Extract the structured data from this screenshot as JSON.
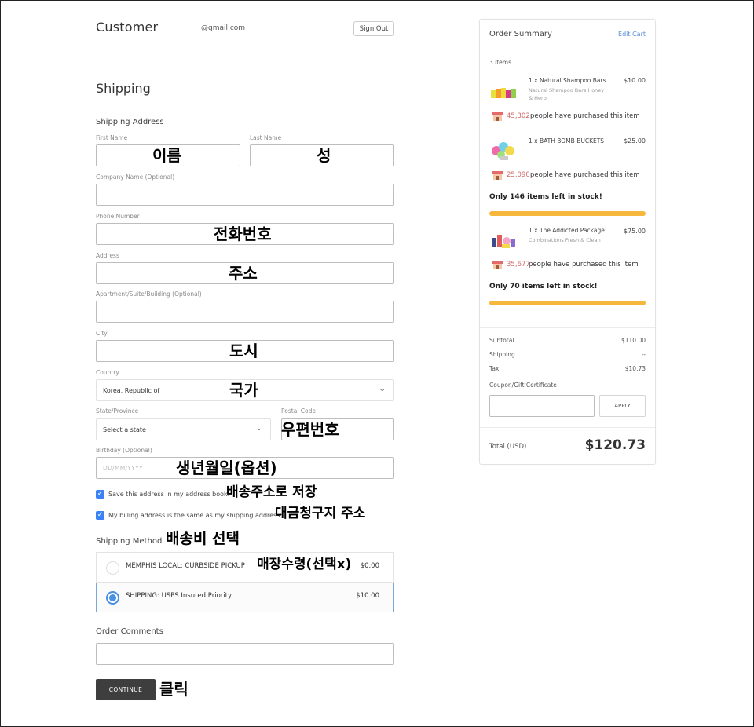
{
  "header": {
    "title": "Customer",
    "email": "@gmail.com",
    "sign_out": "Sign Out"
  },
  "shipping": {
    "title": "Shipping",
    "address_label": "Shipping Address",
    "fields": {
      "first_name": {
        "label": "First Name",
        "annotation": "이름"
      },
      "last_name": {
        "label": "Last Name",
        "annotation": "성"
      },
      "company": {
        "label": "Company Name (Optional)"
      },
      "phone": {
        "label": "Phone Number",
        "annotation": "전화번호"
      },
      "address": {
        "label": "Address",
        "annotation": "주소"
      },
      "apartment": {
        "label": "Apartment/Suite/Building (Optional)"
      },
      "city": {
        "label": "City",
        "annotation": "도시"
      },
      "country": {
        "label": "Country",
        "value": "Korea, Republic of",
        "annotation": "국가"
      },
      "state": {
        "label": "State/Province",
        "value": "Select a state"
      },
      "postal": {
        "label": "Postal Code",
        "annotation": "우편번호"
      },
      "birthday": {
        "label": "Birthday (Optional)",
        "placeholder": "DD/MM/YYYY",
        "annotation": "생년월일(옵션)"
      }
    },
    "save_address": {
      "label": "Save this address in my address book.",
      "annotation": "배송주소로 저장",
      "checked": true
    },
    "billing_same": {
      "label": "My billing address is the same as my shipping address.",
      "annotation": "대금청구지 주소",
      "checked": true
    }
  },
  "shipping_method": {
    "label": "Shipping Method",
    "annotation": "배송비 선택",
    "options": [
      {
        "name": "MEMPHIS LOCAL: CURBSIDE PICKUP",
        "price": "$0.00",
        "annotation": "매장수령(선택x)",
        "selected": false
      },
      {
        "name": "SHIPPING: USPS Insured Priority",
        "price": "$10.00",
        "selected": true
      }
    ]
  },
  "comments": {
    "label": "Order Comments"
  },
  "continue": {
    "label": "CONTINUE",
    "annotation": "클릭"
  },
  "summary": {
    "title": "Order Summary",
    "edit": "Edit Cart",
    "count": "3 items",
    "items": [
      {
        "name": "1 x Natural Shampoo Bars",
        "desc": "Natural Shampoo Bars Honey & Herb",
        "price": "$10.00",
        "purchased_num": "45,302",
        "purchased_text": "people have purchased this item"
      },
      {
        "name": "1 x BATH BOMB BUCKETS",
        "desc": "",
        "price": "$25.00",
        "purchased_num": "25,090",
        "purchased_text": "people have purchased this item",
        "stock": "Only 146 items left in stock!"
      },
      {
        "name": "1 x The Addicted Package",
        "desc": "Combinations Fresh & Clean",
        "price": "$75.00",
        "purchased_num": "35,677",
        "purchased_text": "people have purchased this item",
        "stock": "Only 70 items left in stock!"
      }
    ],
    "subtotal_label": "Subtotal",
    "subtotal": "$110.00",
    "shipping_label": "Shipping",
    "shipping": "--",
    "tax_label": "Tax",
    "tax": "$10.73",
    "coupon_label": "Coupon/Gift Certificate",
    "apply": "APPLY",
    "total_label": "Total (USD)",
    "total": "$120.73"
  },
  "colors": {
    "accent": "#4a90e2",
    "stock_bar": "#f6b73c",
    "purchase_count": "#d06a6a",
    "continue_bg": "#3e3e3e"
  }
}
